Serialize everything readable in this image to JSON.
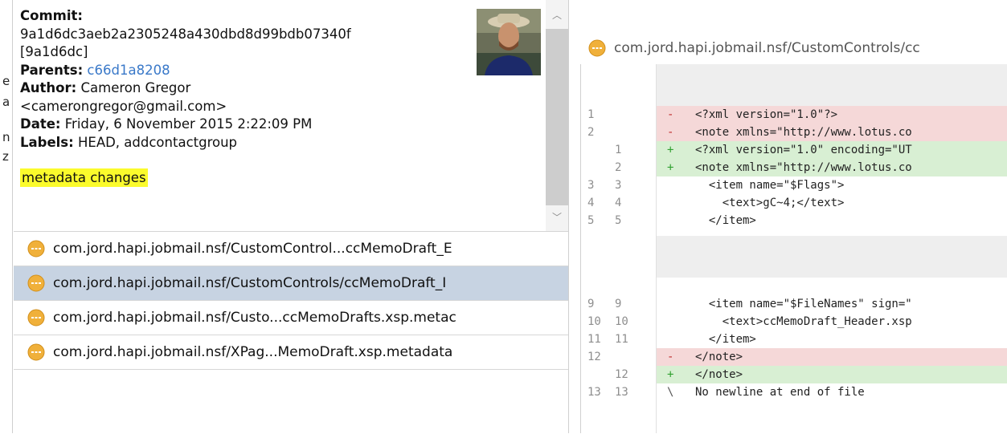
{
  "edge_chars": [
    "e",
    "a",
    "n",
    "z"
  ],
  "commit": {
    "commit_label": "Commit:",
    "hash": "9a1d6dc3aeb2a2305248a430dbd8d99bdb07340f",
    "short_hash": "[9a1d6dc]",
    "parents_label": "Parents:",
    "parents_value": "c66d1a8208",
    "author_label": "Author:",
    "author_name": "Cameron Gregor",
    "author_email": "<camerongregor@gmail.com>",
    "date_label": "Date:",
    "date_value": "Friday, 6 November 2015 2:22:09 PM",
    "labels_label": "Labels:",
    "labels_value": "HEAD, addcontactgroup",
    "message": "metadata changes"
  },
  "files": [
    {
      "name": "com.jord.hapi.jobmail.nsf/CustomControl...ccMemoDraft_E"
    },
    {
      "name": "com.jord.hapi.jobmail.nsf/CustomControls/ccMemoDraft_I",
      "selected": true
    },
    {
      "name": "com.jord.hapi.jobmail.nsf/Custo...ccMemoDrafts.xsp.metac"
    },
    {
      "name": "com.jord.hapi.jobmail.nsf/XPag...MemoDraft.xsp.metadata"
    }
  ],
  "diff": {
    "title": "com.jord.hapi.jobmail.nsf/CustomControls/cc",
    "lines": [
      {
        "type": "del",
        "old": "1",
        "new": "",
        "sign": "-",
        "code": "<?xml version=\"1.0\"?>"
      },
      {
        "type": "del",
        "old": "2",
        "new": "",
        "sign": "-",
        "code": "<note xmlns=\"http://www.lotus.co"
      },
      {
        "type": "add",
        "old": "",
        "new": "1",
        "sign": "+",
        "code": "<?xml version=\"1.0\" encoding=\"UT"
      },
      {
        "type": "add",
        "old": "",
        "new": "2",
        "sign": "+",
        "code": "<note xmlns=\"http://www.lotus.co"
      },
      {
        "type": "ctx",
        "old": "3",
        "new": "3",
        "sign": "",
        "code": "  <item name=\"$Flags\">"
      },
      {
        "type": "ctx",
        "old": "4",
        "new": "4",
        "sign": "",
        "code": "    <text>gC~4;</text>"
      },
      {
        "type": "ctx",
        "old": "5",
        "new": "5",
        "sign": "",
        "code": "  </item>"
      },
      {
        "type": "ctx",
        "old": "9",
        "new": "9",
        "sign": "",
        "code": "  <item name=\"$FileNames\" sign=\""
      },
      {
        "type": "ctx",
        "old": "10",
        "new": "10",
        "sign": "",
        "code": "    <text>ccMemoDraft_Header.xsp"
      },
      {
        "type": "ctx",
        "old": "11",
        "new": "11",
        "sign": "",
        "code": "  </item>"
      },
      {
        "type": "del",
        "old": "12",
        "new": "",
        "sign": "-",
        "code": "</note>"
      },
      {
        "type": "add",
        "old": "",
        "new": "12",
        "sign": "+",
        "code": "</note>"
      },
      {
        "type": "ctx",
        "old": "13",
        "new": "13",
        "sign": "\\",
        "code": "No newline at end of file"
      }
    ]
  },
  "colors": {
    "link": "#3a79c9",
    "highlight": "#fbfb2c",
    "selected_row": "#c7d3e2",
    "deleted_line": "#f5d8d8",
    "added_line": "#d8efd3",
    "file_icon": "#f0b03a"
  }
}
